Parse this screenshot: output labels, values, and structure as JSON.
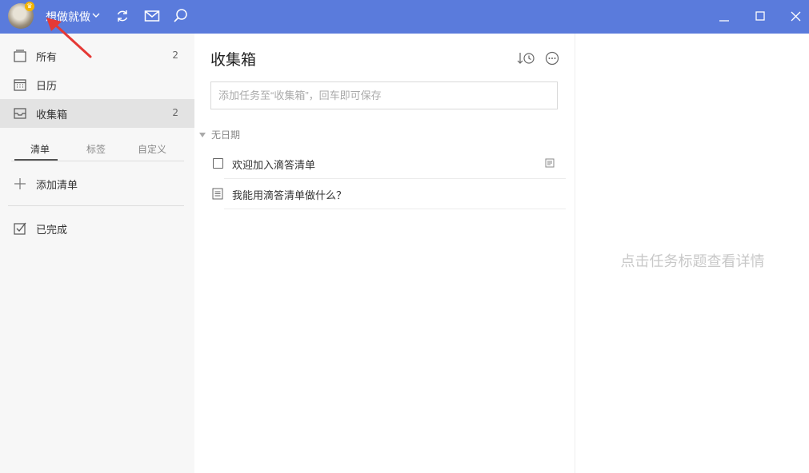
{
  "titlebar": {
    "username": "想做就做",
    "accent": "#5a7bdc",
    "icons": [
      "sync-icon",
      "mail-icon",
      "search-icon"
    ],
    "window_controls": [
      "minimize-icon",
      "maximize-icon",
      "close-icon"
    ]
  },
  "sidebar": {
    "items": [
      {
        "label": "所有",
        "count": "2",
        "icon": "all-tasks-icon"
      },
      {
        "label": "日历",
        "count": "",
        "icon": "calendar-icon"
      },
      {
        "label": "收集箱",
        "count": "2",
        "icon": "inbox-icon",
        "active": true
      }
    ],
    "tabs": [
      {
        "label": "清单",
        "active": true
      },
      {
        "label": "标签"
      },
      {
        "label": "自定义"
      }
    ],
    "add_list": "添加清单",
    "completed": "已完成"
  },
  "main": {
    "title": "收集箱",
    "add_placeholder": "添加任务至“收集箱”，回车即可保存",
    "section": "无日期",
    "tasks": [
      {
        "title": "欢迎加入滴答清单",
        "type": "checkbox",
        "has_note": true
      },
      {
        "title": "我能用滴答清单做什么？",
        "type": "note",
        "has_note": false
      }
    ]
  },
  "detail": {
    "hint": "点击任务标题查看详情"
  }
}
